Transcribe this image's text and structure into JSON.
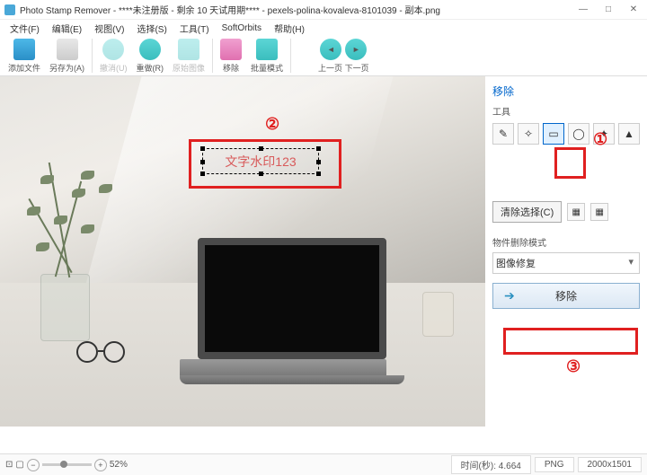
{
  "titlebar": {
    "text": "Photo Stamp Remover - ****未注册版 - 剩余 10 天试用期**** - pexels-polina-kovaleva-8101039 - 副本.png"
  },
  "win": {
    "min": "—",
    "max": "□",
    "close": "✕"
  },
  "menu": {
    "file": "文件(F)",
    "edit": "编辑(E)",
    "view": "视图(V)",
    "select": "选择(S)",
    "tools": "工具(T)",
    "softorbits": "SoftOrbits",
    "help": "帮助(H)"
  },
  "toolbar": {
    "addfile": "添加文件",
    "saveas": "另存为(A)",
    "undo": "撤消(U)",
    "redo": "重做(R)",
    "original": "原始图像",
    "remove": "移除",
    "batch": "批量模式",
    "prev": "上一页",
    "next": "下一页"
  },
  "watermark_text": "文字水印123",
  "side": {
    "title": "移除",
    "tools_label": "工具",
    "clear_selection": "清除选择(C)",
    "mode_label": "物件删除模式",
    "mode_value": "图像修复",
    "remove_btn": "移除"
  },
  "status": {
    "zoom_pct": "52%",
    "time_label": "时间(秒):",
    "time_val": "4.664",
    "format": "PNG",
    "dimensions": "2000x1501"
  },
  "annotations": {
    "n1": "①",
    "n2": "②",
    "n3": "③"
  }
}
